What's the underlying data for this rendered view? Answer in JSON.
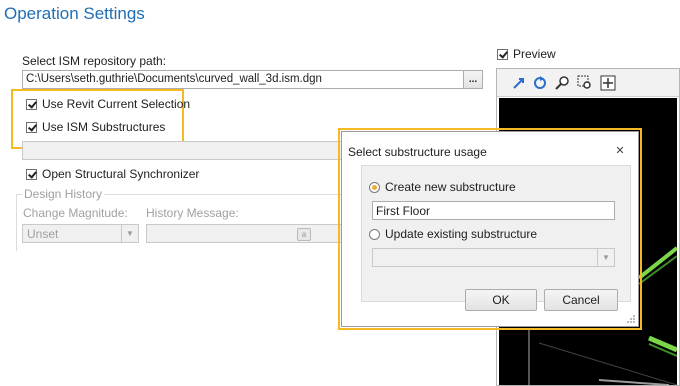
{
  "header": {
    "title": "Operation Settings"
  },
  "repository": {
    "label": "Select ISM repository path:",
    "path": "C:\\Users\\seth.guthrie\\Documents\\curved_wall_3d.ism.dgn",
    "browse_label": "..."
  },
  "options": {
    "use_revit_selection": "Use Revit Current Selection",
    "use_ism_substructures": "Use ISM Substructures",
    "open_structural_sync": "Open Structural Synchronizer"
  },
  "design_history": {
    "group_label": "Design History",
    "change_magnitude_label": "Change Magnitude:",
    "change_magnitude_value": "Unset",
    "history_message_label": "History Message:"
  },
  "preview": {
    "label": "Preview"
  },
  "dialog": {
    "title": "Select substructure usage",
    "close_label": "✕",
    "create_new_label": "Create new substructure",
    "create_new_value": "First Floor",
    "update_existing_label": "Update existing substructure",
    "ok_label": "OK",
    "cancel_label": "Cancel"
  },
  "colors": {
    "title": "#1f6eb5",
    "highlight": "#f5b923",
    "preview_bg": "#000000",
    "model_green": "#7cd64a"
  }
}
